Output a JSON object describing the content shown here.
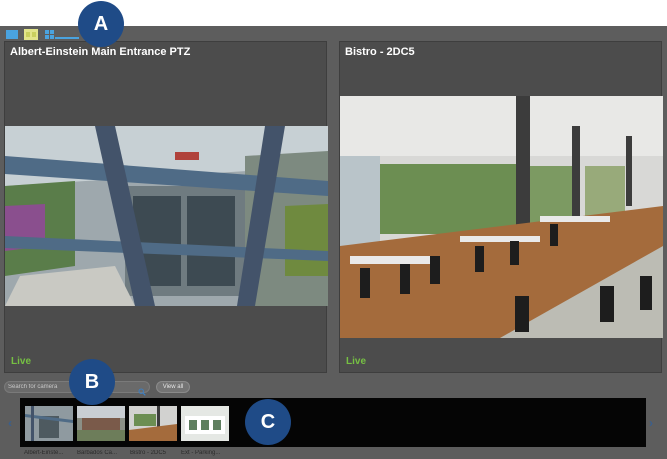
{
  "layout_buttons": [
    {
      "icon": "single-view-icon"
    },
    {
      "icon": "two-view-icon"
    },
    {
      "icon": "grid-view-icon"
    }
  ],
  "panels": [
    {
      "title": "Albert-Einstein Main Entrance PTZ",
      "status": "Live"
    },
    {
      "title": "Bistro - 2DC5",
      "status": "Live"
    }
  ],
  "search": {
    "placeholder": "Search for camera",
    "icon": "search-icon"
  },
  "view_all": "View all",
  "thumbnails": [
    {
      "label": "Albert-Einste..."
    },
    {
      "label": "Barbados Ca..."
    },
    {
      "label": "Bistro - 2DC5"
    },
    {
      "label": "Ext - Parking..."
    }
  ],
  "callouts": [
    "A",
    "B",
    "C"
  ],
  "colors": {
    "live": "#76c043",
    "callout": "#1f4b87",
    "background": "#5d5d5d"
  }
}
